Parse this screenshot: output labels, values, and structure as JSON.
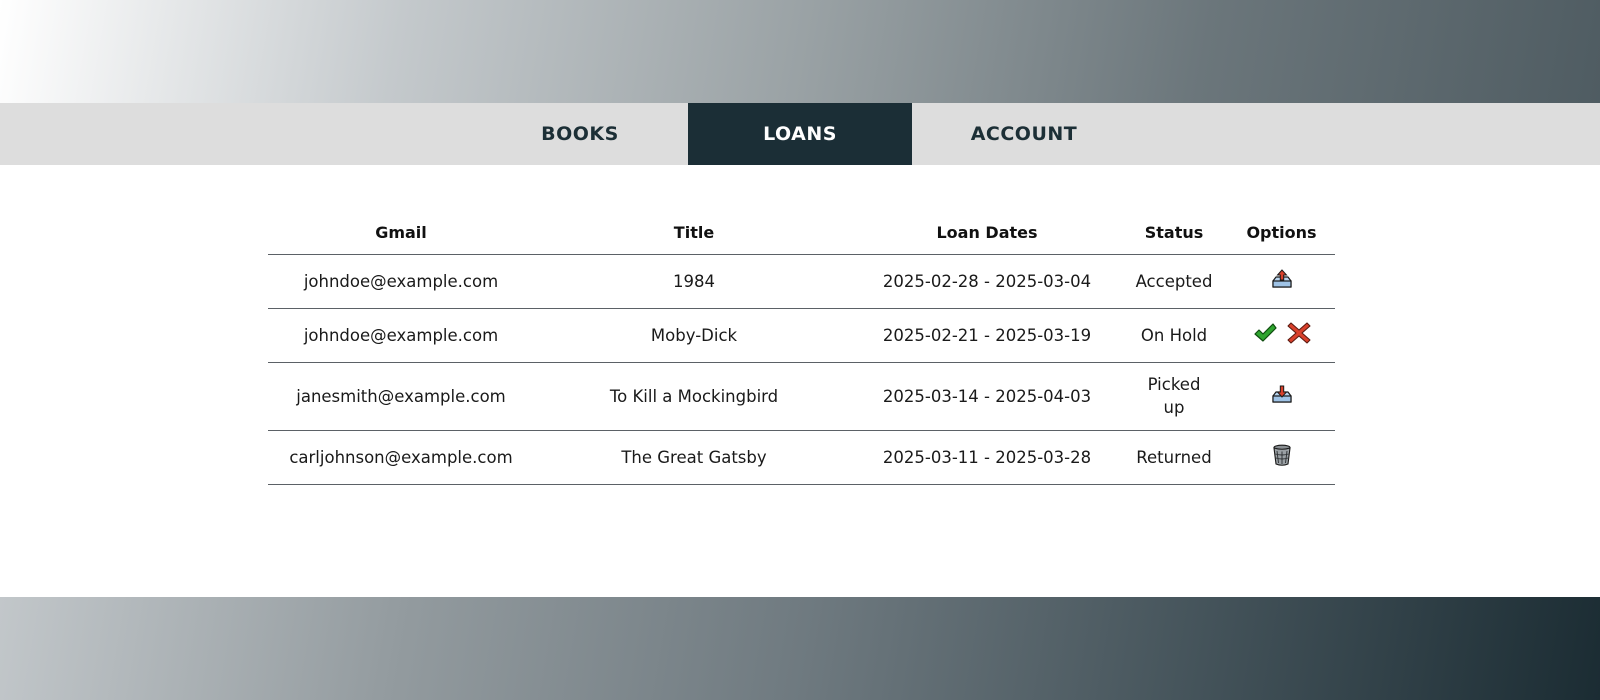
{
  "nav": {
    "tabs": [
      {
        "label": "BOOKS",
        "active": false
      },
      {
        "label": "LOANS",
        "active": true
      },
      {
        "label": "ACCOUNT",
        "active": false
      }
    ]
  },
  "table": {
    "headers": [
      "Gmail",
      "Title",
      "Loan Dates",
      "Status",
      "Options"
    ],
    "rows": [
      {
        "gmail": "johndoe@example.com",
        "title": "1984",
        "dates": "2025-02-28 - 2025-03-04",
        "status": "Accepted",
        "options": [
          "upload-icon"
        ]
      },
      {
        "gmail": "johndoe@example.com",
        "title": "Moby-Dick",
        "dates": "2025-02-21 - 2025-03-19",
        "status": "On Hold",
        "options": [
          "checkmark-icon",
          "cross-icon"
        ]
      },
      {
        "gmail": "janesmith@example.com",
        "title": "To Kill a Mockingbird",
        "dates": "2025-03-14 - 2025-04-03",
        "status": "Picked up",
        "options": [
          "download-icon"
        ]
      },
      {
        "gmail": "carljohnson@example.com",
        "title": "The Great Gatsby",
        "dates": "2025-03-11 - 2025-03-28",
        "status": "Returned",
        "options": [
          "trash-icon"
        ]
      }
    ]
  },
  "colors": {
    "nav_active_bg": "#1b2e36",
    "nav_bg": "#dddddd",
    "nav_text": "#1c2f36",
    "border": "#5b6166"
  }
}
